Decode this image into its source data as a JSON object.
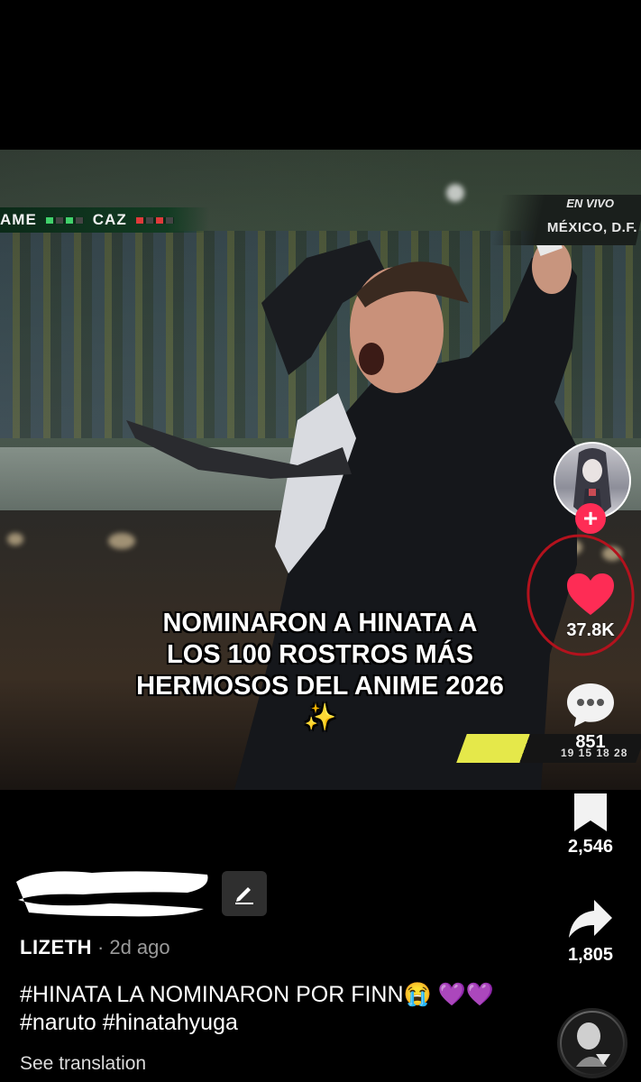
{
  "video": {
    "scoreboard": {
      "team_left": "AME",
      "team_right": "CAZ"
    },
    "live_badge": {
      "line1": "EN VIVO",
      "line2": "MÉXICO, D.F."
    },
    "caption": "NOMINARON A HINATA A LOS 100 ROSTROS MÁS HERMOSOS DEL ANIME 2026 ✨",
    "mini_score_digits": "19 15 18 28"
  },
  "rail": {
    "follow_symbol": "+",
    "likes": {
      "count": "37.8K",
      "icon": "heart-icon",
      "color": "#fe2c55"
    },
    "comments": {
      "count": "851",
      "icon": "comment-icon"
    },
    "saves": {
      "count": "2,546",
      "icon": "bookmark-icon"
    },
    "shares": {
      "count": "1,805",
      "icon": "share-icon"
    }
  },
  "post": {
    "author": "LIZETH",
    "separator": "·",
    "time_ago": "2d ago",
    "description": "#HINATA LA NOMINARON POR FINN😭 💜💜 #naruto #hinatahyuga",
    "see_translation": "See translation"
  },
  "annotation_color": "#b3121d"
}
